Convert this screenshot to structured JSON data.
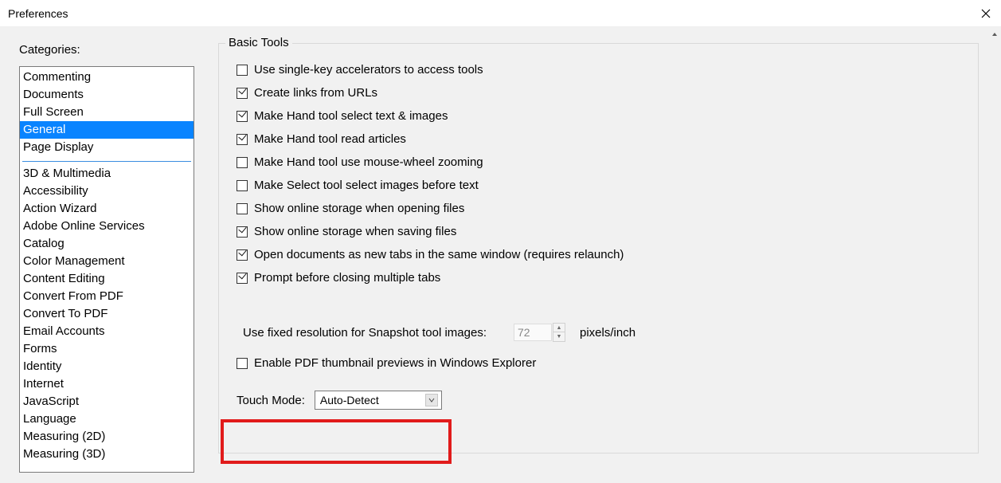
{
  "window": {
    "title": "Preferences"
  },
  "sidebar": {
    "header": "Categories:",
    "top_items": [
      "Commenting",
      "Documents",
      "Full Screen",
      "General",
      "Page Display"
    ],
    "selected": "General",
    "bottom_items": [
      "3D & Multimedia",
      "Accessibility",
      "Action Wizard",
      "Adobe Online Services",
      "Catalog",
      "Color Management",
      "Content Editing",
      "Convert From PDF",
      "Convert To PDF",
      "Email Accounts",
      "Forms",
      "Identity",
      "Internet",
      "JavaScript",
      "Language",
      "Measuring (2D)",
      "Measuring (3D)"
    ]
  },
  "group": {
    "title": "Basic Tools",
    "checks": [
      {
        "label": "Use single-key accelerators to access tools",
        "checked": false
      },
      {
        "label": "Create links from URLs",
        "checked": true
      },
      {
        "label": "Make Hand tool select text & images",
        "checked": true
      },
      {
        "label": "Make Hand tool read articles",
        "checked": true
      },
      {
        "label": "Make Hand tool use mouse-wheel zooming",
        "checked": false
      },
      {
        "label": "Make Select tool select images before text",
        "checked": false
      },
      {
        "label": "Show online storage when opening files",
        "checked": false
      },
      {
        "label": "Show online storage when saving files",
        "checked": true
      },
      {
        "label": "Open documents as new tabs in the same window (requires relaunch)",
        "checked": true
      },
      {
        "label": "Prompt before closing multiple tabs",
        "checked": true
      }
    ],
    "resolution": {
      "label": "Use fixed resolution for Snapshot tool images:",
      "checked": false,
      "value": "72",
      "units": "pixels/inch"
    },
    "thumb": {
      "label": "Enable PDF thumbnail previews in Windows Explorer",
      "checked": false
    },
    "touch": {
      "label": "Touch Mode:",
      "value": "Auto-Detect"
    }
  }
}
